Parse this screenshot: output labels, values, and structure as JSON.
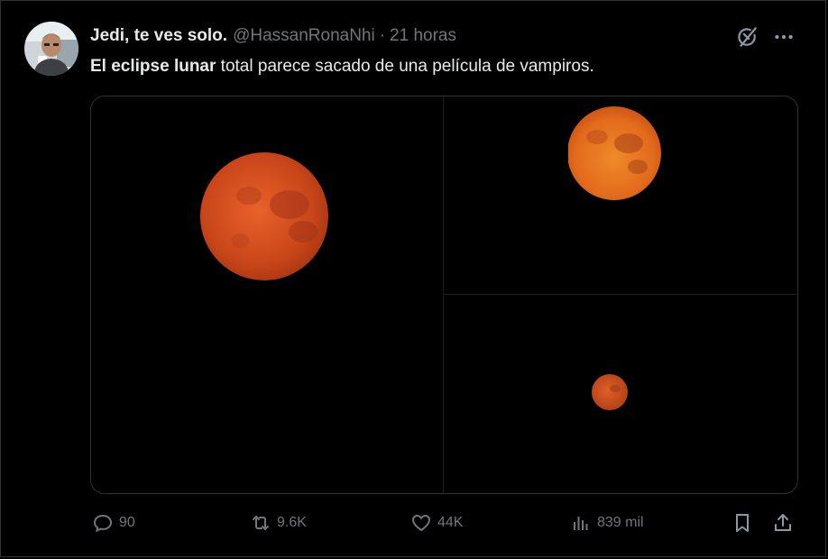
{
  "tweet": {
    "display_name": "Jedi, te ves solo.",
    "handle": "@HassanRonaNhi",
    "separator": "·",
    "time": "21 horas",
    "text_bold": "El eclipse lunar",
    "text_rest": " total parece sacado de una película de vampiros."
  },
  "header_icons": {
    "grok": "grok-icon",
    "more": "more-icon"
  },
  "media": {
    "image_count": 3,
    "moon_color": "#d2521c"
  },
  "actions": {
    "replies": "90",
    "retweets": "9.6K",
    "likes": "44K",
    "views": "839 mil"
  },
  "colors": {
    "background": "#000000",
    "text": "#e7e9ea",
    "muted": "#71767b",
    "border": "#2f3336"
  }
}
